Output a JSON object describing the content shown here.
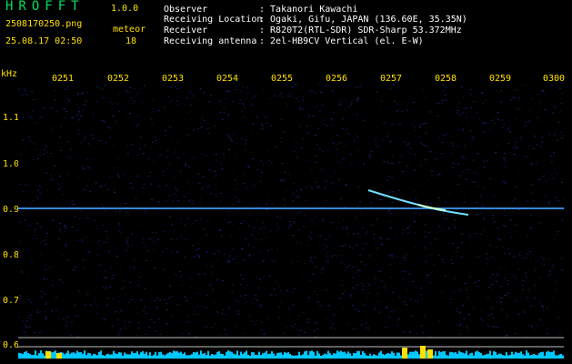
{
  "app": {
    "title": "HROFFT",
    "version": "1.0.0"
  },
  "capture": {
    "filename": "2508170250.png",
    "datetime": "25.08.17 02:50",
    "meteor_label": "meteor",
    "meteor_count": "18"
  },
  "info": {
    "observer_label": "Observer",
    "observer_value": ": Takanori Kawachi",
    "location_label": "Receiving Location",
    "location_value": ": Ogaki, Gifu, JAPAN (136.60E, 35.35N)",
    "receiver_label": "Receiver",
    "receiver_value": ": R820T2(RTL-SDR) SDR-Sharp 53.372MHz",
    "antenna_label": "Receiving antenna",
    "antenna_value": ": 2el-HB9CV Vertical (el. E-W)"
  },
  "axis": {
    "unit_label": "kHz",
    "time_ticks": [
      "0251",
      "0252",
      "0253",
      "0254",
      "0255",
      "0256",
      "0257",
      "0258",
      "0259",
      "0300"
    ],
    "freq_ticks": [
      "1.1",
      "1.0",
      "0.9",
      "0.8",
      "0.7",
      "0.6"
    ]
  },
  "colors": {
    "background": "#000000",
    "noise": "#1a2a8a",
    "carrier": "#3fa0ff",
    "meteor": "#6fe0ff",
    "level_bar": "#00c8ff",
    "level_peak": "#ffe000",
    "text_yellow": "#ffe000",
    "text_green": "#00e060"
  }
}
